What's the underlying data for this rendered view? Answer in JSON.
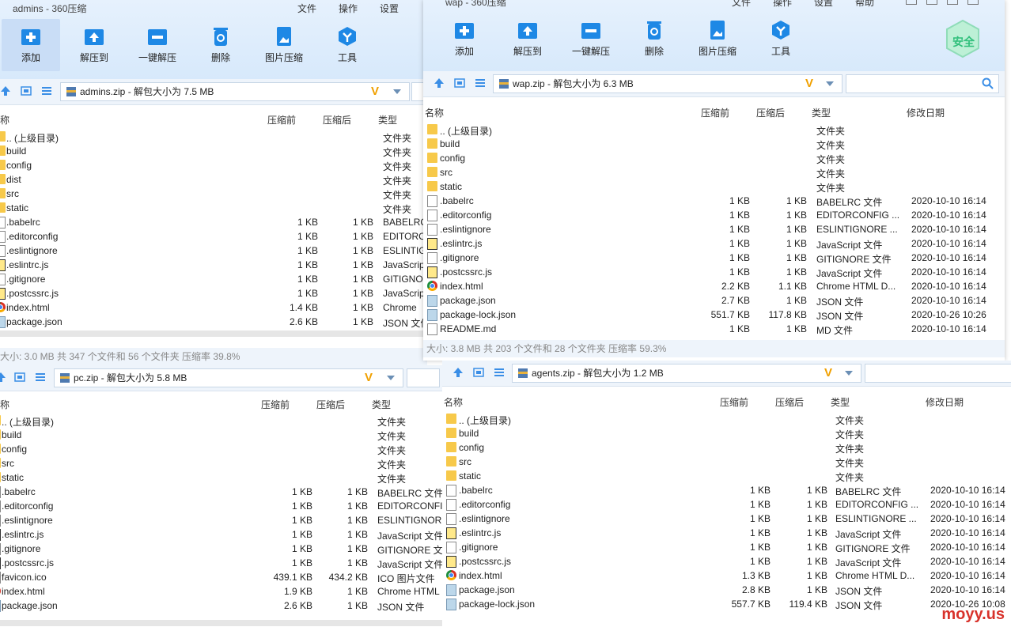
{
  "windows": {
    "admins": {
      "title": "admins - 360压缩",
      "menu": [
        "文件",
        "操作",
        "设置"
      ],
      "tools": [
        "添加",
        "解压到",
        "一键解压",
        "删除",
        "图片压缩",
        "工具"
      ],
      "path": "admins.zip - 解包大小为 7.5 MB",
      "columns": [
        "称",
        "压缩前",
        "压缩后",
        "类型"
      ],
      "rows": [
        {
          "icon": "folder",
          "name": ".. (上级目录)",
          "before": "",
          "after": "",
          "type": "文件夹"
        },
        {
          "icon": "folder",
          "name": "build",
          "before": "",
          "after": "",
          "type": "文件夹"
        },
        {
          "icon": "folder",
          "name": "config",
          "before": "",
          "after": "",
          "type": "文件夹"
        },
        {
          "icon": "folder",
          "name": "dist",
          "before": "",
          "after": "",
          "type": "文件夹"
        },
        {
          "icon": "folder",
          "name": "src",
          "before": "",
          "after": "",
          "type": "文件夹"
        },
        {
          "icon": "folder",
          "name": "static",
          "before": "",
          "after": "",
          "type": "文件夹"
        },
        {
          "icon": "doc",
          "name": ".babelrc",
          "before": "1 KB",
          "after": "1 KB",
          "type": "BABELRC"
        },
        {
          "icon": "doc",
          "name": ".editorconfig",
          "before": "1 KB",
          "after": "1 KB",
          "type": "EDITORC"
        },
        {
          "icon": "doc",
          "name": ".eslintignore",
          "before": "1 KB",
          "after": "1 KB",
          "type": "ESLINTIG"
        },
        {
          "icon": "js",
          "name": ".eslintrc.js",
          "before": "1 KB",
          "after": "1 KB",
          "type": "JavaScrip"
        },
        {
          "icon": "doc",
          "name": ".gitignore",
          "before": "1 KB",
          "after": "1 KB",
          "type": "GITIGNO"
        },
        {
          "icon": "js",
          "name": ".postcssrc.js",
          "before": "1 KB",
          "after": "1 KB",
          "type": "JavaScrip"
        },
        {
          "icon": "chrome",
          "name": "index.html",
          "before": "1.4 KB",
          "after": "1 KB",
          "type": "Chrome"
        },
        {
          "icon": "json",
          "name": "package.json",
          "before": "2.6 KB",
          "after": "1 KB",
          "type": "JSON 文件"
        }
      ],
      "status": "大小: 3.0 MB 共 347 个文件和 56 个文件夹 压缩率 39.8%"
    },
    "wap": {
      "title": "wap - 360压缩",
      "menu": [
        "文件",
        "操作",
        "设置",
        "帮助"
      ],
      "tools": [
        "添加",
        "解压到",
        "一键解压",
        "删除",
        "图片压缩",
        "工具"
      ],
      "badge": "安全",
      "path": "wap.zip - 解包大小为 6.3 MB",
      "columns": [
        "名称",
        "压缩前",
        "压缩后",
        "类型",
        "修改日期"
      ],
      "rows": [
        {
          "icon": "folder",
          "name": ".. (上级目录)",
          "before": "",
          "after": "",
          "type": "文件夹",
          "date": ""
        },
        {
          "icon": "folder",
          "name": "build",
          "before": "",
          "after": "",
          "type": "文件夹",
          "date": ""
        },
        {
          "icon": "folder",
          "name": "config",
          "before": "",
          "after": "",
          "type": "文件夹",
          "date": ""
        },
        {
          "icon": "folder",
          "name": "src",
          "before": "",
          "after": "",
          "type": "文件夹",
          "date": ""
        },
        {
          "icon": "folder",
          "name": "static",
          "before": "",
          "after": "",
          "type": "文件夹",
          "date": ""
        },
        {
          "icon": "doc",
          "name": ".babelrc",
          "before": "1 KB",
          "after": "1 KB",
          "type": "BABELRC 文件",
          "date": "2020-10-10 16:14"
        },
        {
          "icon": "doc",
          "name": ".editorconfig",
          "before": "1 KB",
          "after": "1 KB",
          "type": "EDITORCONFIG ...",
          "date": "2020-10-10 16:14"
        },
        {
          "icon": "doc",
          "name": ".eslintignore",
          "before": "1 KB",
          "after": "1 KB",
          "type": "ESLINTIGNORE ...",
          "date": "2020-10-10 16:14"
        },
        {
          "icon": "js",
          "name": ".eslintrc.js",
          "before": "1 KB",
          "after": "1 KB",
          "type": "JavaScript 文件",
          "date": "2020-10-10 16:14"
        },
        {
          "icon": "doc",
          "name": ".gitignore",
          "before": "1 KB",
          "after": "1 KB",
          "type": "GITIGNORE 文件",
          "date": "2020-10-10 16:14"
        },
        {
          "icon": "js",
          "name": ".postcssrc.js",
          "before": "1 KB",
          "after": "1 KB",
          "type": "JavaScript 文件",
          "date": "2020-10-10 16:14"
        },
        {
          "icon": "chrome",
          "name": "index.html",
          "before": "2.2 KB",
          "after": "1.1 KB",
          "type": "Chrome HTML D...",
          "date": "2020-10-10 16:14"
        },
        {
          "icon": "json",
          "name": "package.json",
          "before": "2.7 KB",
          "after": "1 KB",
          "type": "JSON 文件",
          "date": "2020-10-10 16:14"
        },
        {
          "icon": "json",
          "name": "package-lock.json",
          "before": "551.7 KB",
          "after": "117.8 KB",
          "type": "JSON 文件",
          "date": "2020-10-26 10:26"
        },
        {
          "icon": "doc",
          "name": "README.md",
          "before": "1 KB",
          "after": "1 KB",
          "type": "MD 文件",
          "date": "2020-10-10 16:14"
        }
      ],
      "status": "大小: 3.8 MB 共 203 个文件和 28 个文件夹 压缩率 59.3%"
    },
    "pc": {
      "path": "pc.zip - 解包大小为 5.8 MB",
      "columns": [
        "称",
        "压缩前",
        "压缩后",
        "类型"
      ],
      "rows": [
        {
          "icon": "folder",
          "name": ".. (上级目录)",
          "before": "",
          "after": "",
          "type": "文件夹"
        },
        {
          "icon": "folder",
          "name": "build",
          "before": "",
          "after": "",
          "type": "文件夹"
        },
        {
          "icon": "folder",
          "name": "config",
          "before": "",
          "after": "",
          "type": "文件夹"
        },
        {
          "icon": "folder",
          "name": "src",
          "before": "",
          "after": "",
          "type": "文件夹"
        },
        {
          "icon": "folder",
          "name": "static",
          "before": "",
          "after": "",
          "type": "文件夹"
        },
        {
          "icon": "doc",
          "name": ".babelrc",
          "before": "1 KB",
          "after": "1 KB",
          "type": "BABELRC 文件"
        },
        {
          "icon": "doc",
          "name": ".editorconfig",
          "before": "1 KB",
          "after": "1 KB",
          "type": "EDITORCONFI"
        },
        {
          "icon": "doc",
          "name": ".eslintignore",
          "before": "1 KB",
          "after": "1 KB",
          "type": "ESLINTIGNOR"
        },
        {
          "icon": "js",
          "name": ".eslintrc.js",
          "before": "1 KB",
          "after": "1 KB",
          "type": "JavaScript 文件"
        },
        {
          "icon": "doc",
          "name": ".gitignore",
          "before": "1 KB",
          "after": "1 KB",
          "type": "GITIGNORE 文"
        },
        {
          "icon": "js",
          "name": ".postcssrc.js",
          "before": "1 KB",
          "after": "1 KB",
          "type": "JavaScript 文件"
        },
        {
          "icon": "doc",
          "name": "favicon.ico",
          "before": "439.1 KB",
          "after": "434.2 KB",
          "type": "ICO 图片文件"
        },
        {
          "icon": "chrome",
          "name": "index.html",
          "before": "1.9 KB",
          "after": "1 KB",
          "type": "Chrome HTML"
        },
        {
          "icon": "json",
          "name": "package.json",
          "before": "2.6 KB",
          "after": "1 KB",
          "type": "JSON 文件"
        }
      ]
    },
    "agents": {
      "path": "agents.zip - 解包大小为 1.2 MB",
      "columns": [
        "名称",
        "压缩前",
        "压缩后",
        "类型",
        "修改日期"
      ],
      "rows": [
        {
          "icon": "folder",
          "name": ".. (上级目录)",
          "before": "",
          "after": "",
          "type": "文件夹",
          "date": ""
        },
        {
          "icon": "folder",
          "name": "build",
          "before": "",
          "after": "",
          "type": "文件夹",
          "date": ""
        },
        {
          "icon": "folder",
          "name": "config",
          "before": "",
          "after": "",
          "type": "文件夹",
          "date": ""
        },
        {
          "icon": "folder",
          "name": "src",
          "before": "",
          "after": "",
          "type": "文件夹",
          "date": ""
        },
        {
          "icon": "folder",
          "name": "static",
          "before": "",
          "after": "",
          "type": "文件夹",
          "date": ""
        },
        {
          "icon": "doc",
          "name": ".babelrc",
          "before": "1 KB",
          "after": "1 KB",
          "type": "BABELRC 文件",
          "date": "2020-10-10 16:14"
        },
        {
          "icon": "doc",
          "name": ".editorconfig",
          "before": "1 KB",
          "after": "1 KB",
          "type": "EDITORCONFIG ...",
          "date": "2020-10-10 16:14"
        },
        {
          "icon": "doc",
          "name": ".eslintignore",
          "before": "1 KB",
          "after": "1 KB",
          "type": "ESLINTIGNORE ...",
          "date": "2020-10-10 16:14"
        },
        {
          "icon": "js",
          "name": ".eslintrc.js",
          "before": "1 KB",
          "after": "1 KB",
          "type": "JavaScript 文件",
          "date": "2020-10-10 16:14"
        },
        {
          "icon": "doc",
          "name": ".gitignore",
          "before": "1 KB",
          "after": "1 KB",
          "type": "GITIGNORE 文件",
          "date": "2020-10-10 16:14"
        },
        {
          "icon": "js",
          "name": ".postcssrc.js",
          "before": "1 KB",
          "after": "1 KB",
          "type": "JavaScript 文件",
          "date": "2020-10-10 16:14"
        },
        {
          "icon": "chrome",
          "name": "index.html",
          "before": "1.3 KB",
          "after": "1 KB",
          "type": "Chrome HTML D...",
          "date": "2020-10-10 16:14"
        },
        {
          "icon": "json",
          "name": "package.json",
          "before": "2.8 KB",
          "after": "1 KB",
          "type": "JSON 文件",
          "date": "2020-10-10 16:14"
        },
        {
          "icon": "json",
          "name": "package-lock.json",
          "before": "557.7 KB",
          "after": "119.4 KB",
          "type": "JSON 文件",
          "date": "2020-10-26 10:08"
        }
      ]
    }
  },
  "watermark": "moyy.us"
}
